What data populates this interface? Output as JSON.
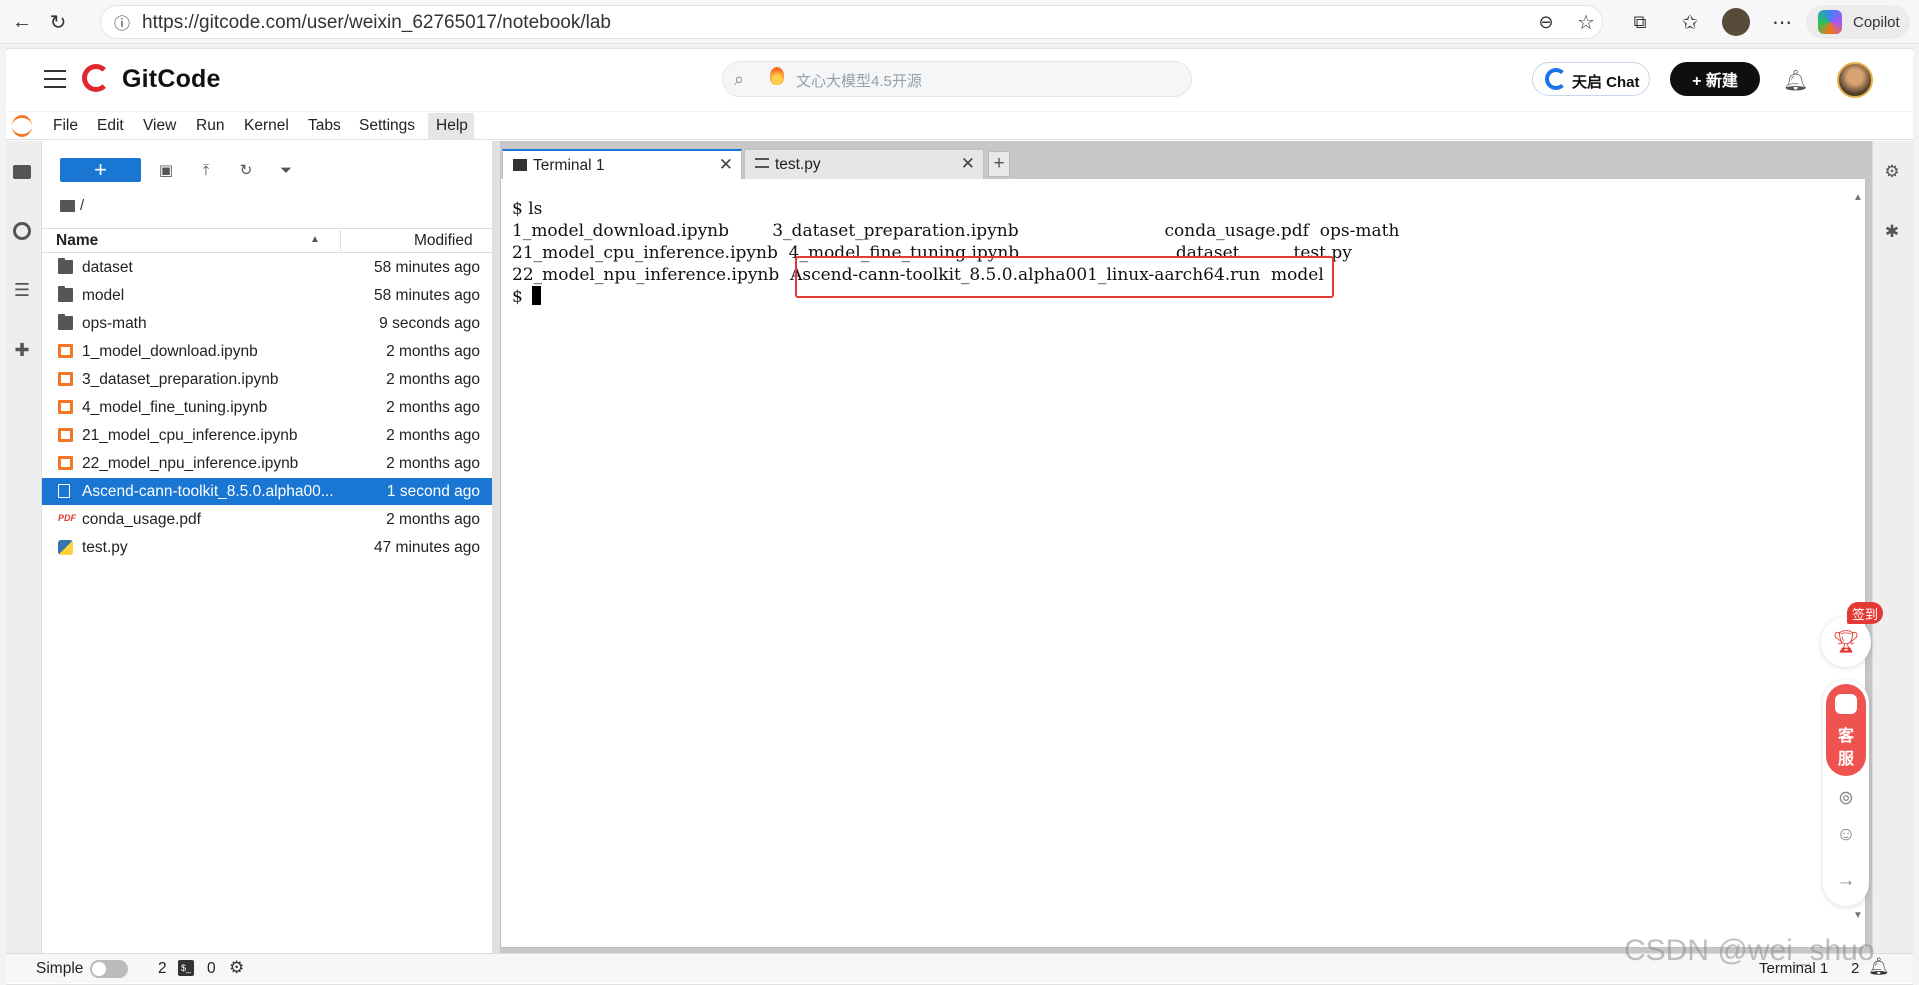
{
  "browser": {
    "url": "https://gitcode.com/user/weixin_62765017/notebook/lab",
    "copilot_label": "Copilot"
  },
  "gitcode": {
    "logo_text": "GitCode",
    "search_placeholder": "文心大模型4.5开源",
    "tianqi_label": "天启 Chat",
    "new_label": "+ 新建"
  },
  "menu": [
    "File",
    "Edit",
    "View",
    "Run",
    "Kernel",
    "Tabs",
    "Settings",
    "Help"
  ],
  "filebrowser": {
    "new_label": "+",
    "breadcrumb": "/",
    "col_name": "Name",
    "col_modified": "Modified",
    "files": [
      {
        "name": "dataset",
        "modified": "58 minutes ago",
        "type": "folder"
      },
      {
        "name": "model",
        "modified": "58 minutes ago",
        "type": "folder"
      },
      {
        "name": "ops-math",
        "modified": "9 seconds ago",
        "type": "folder"
      },
      {
        "name": "1_model_download.ipynb",
        "modified": "2 months ago",
        "type": "notebook"
      },
      {
        "name": "3_dataset_preparation.ipynb",
        "modified": "2 months ago",
        "type": "notebook"
      },
      {
        "name": "4_model_fine_tuning.ipynb",
        "modified": "2 months ago",
        "type": "notebook"
      },
      {
        "name": "21_model_cpu_inference.ipynb",
        "modified": "2 months ago",
        "type": "notebook"
      },
      {
        "name": "22_model_npu_inference.ipynb",
        "modified": "2 months ago",
        "type": "notebook"
      },
      {
        "name": "Ascend-cann-toolkit_8.5.0.alpha00...",
        "modified": "1 second ago",
        "type": "file",
        "selected": true
      },
      {
        "name": "conda_usage.pdf",
        "modified": "2 months ago",
        "type": "pdf"
      },
      {
        "name": "test.py",
        "modified": "47 minutes ago",
        "type": "python"
      }
    ]
  },
  "tabs": [
    {
      "label": "Terminal 1",
      "active": true
    },
    {
      "label": "test.py",
      "active": false
    }
  ],
  "terminal": {
    "lines": [
      "$ ls",
      "1_model_download.ipynb        3_dataset_preparation.ipynb                           conda_usage.pdf  ops-math",
      "21_model_cpu_inference.ipynb  4_model_fine_tuning.ipynb                             dataset          test.py",
      "22_model_npu_inference.ipynb  Ascend-cann-toolkit_8.5.0.alpha001_linux-aarch64.run  model",
      "$ "
    ]
  },
  "floating": {
    "qiandao": "签到",
    "kefu_1": "客",
    "kefu_2": "服"
  },
  "statusbar": {
    "mode": "Simple",
    "terminals": "2",
    "kernels": "0",
    "right_label": "Terminal 1",
    "right_num": "2"
  },
  "watermark": "CSDN @wei_shuo",
  "colors": {
    "accent": "#1976d2",
    "highlight": "#e53935",
    "gitcode_red": "#e0262e"
  }
}
